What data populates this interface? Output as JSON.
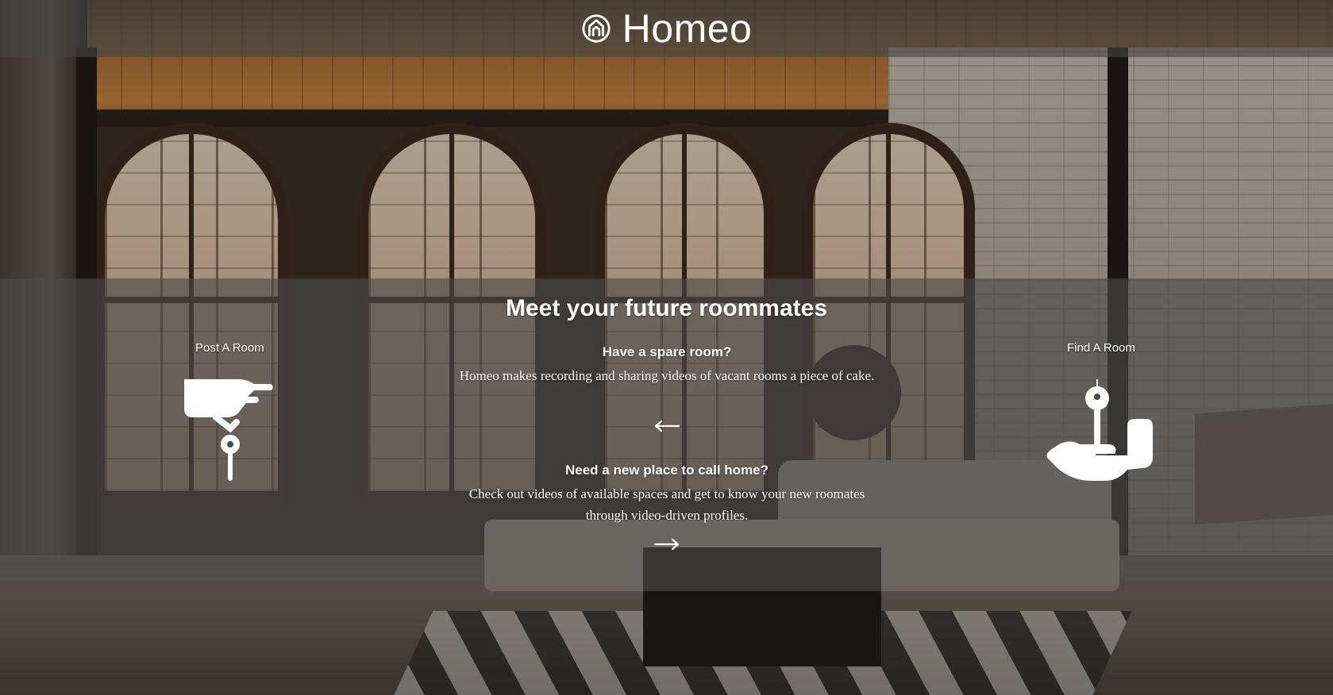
{
  "header": {
    "brand": "Homeo",
    "logo_icon": "house-outline-icon"
  },
  "hero": {
    "headline": "Meet your future roommates",
    "post_label": "Post A Room",
    "find_label": "Find A Room",
    "post_icon": "hand-holding-key-icon",
    "find_icon": "hand-receiving-key-icon",
    "spare_room": {
      "title": "Have a spare room?",
      "body": "Homeo makes recording and sharing videos of vacant rooms a piece of cake.",
      "arrow_icon": "arrow-left-icon"
    },
    "new_place": {
      "title": "Need a new place to call home?",
      "body": "Check out videos of available spaces and get to know your new roomates through video-driven profiles.",
      "arrow_icon": "arrow-right-icon"
    }
  }
}
